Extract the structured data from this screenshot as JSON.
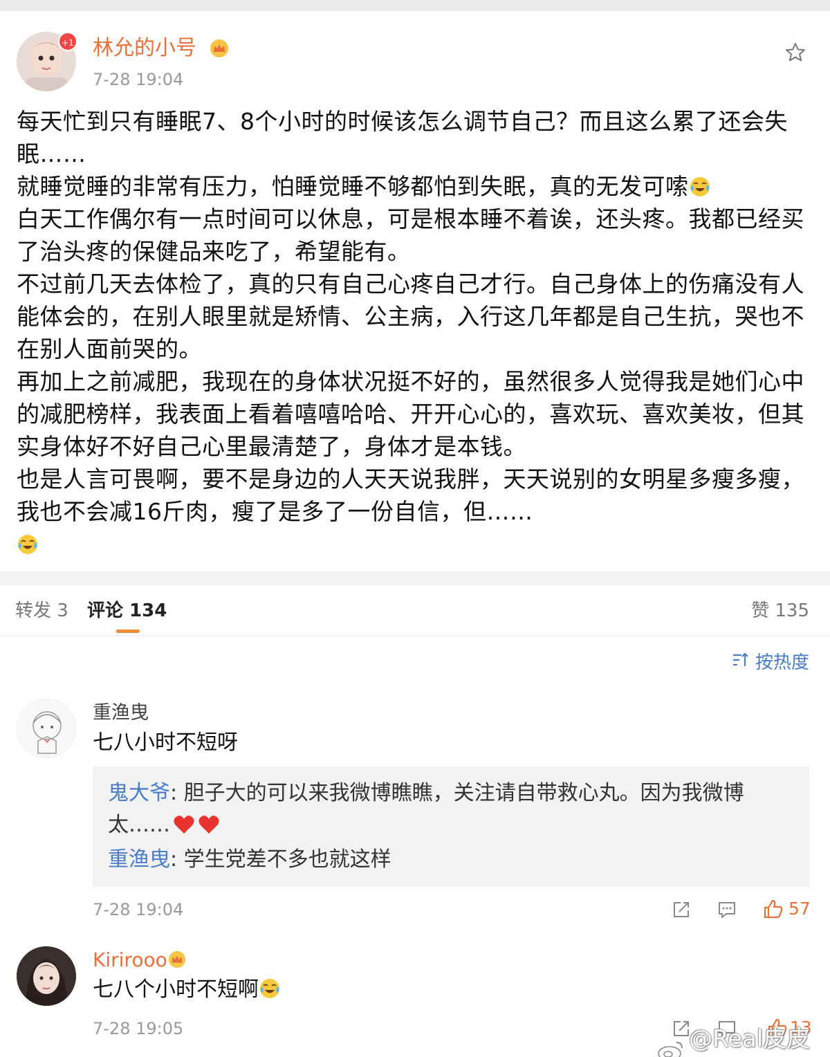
{
  "post": {
    "username": "林允的小号",
    "notification_badge": "+1",
    "timestamp": "7-28 19:04",
    "paragraphs": [
      "每天忙到只有睡眠7、8个小时的时候该怎么调节自己？而且这么累了还会失眠……",
      "就睡觉睡的非常有压力，怕睡觉睡不够都怕到失眠，真的无发可嗦",
      "白天工作偶尔有一点时间可以休息，可是根本睡不着诶，还头疼。我都已经买了治头疼的保健品来吃了，希望能有。",
      "不过前几天去体检了，真的只有自己心疼自己才行。自己身体上的伤痛没有人能体会的，在别人眼里就是矫情、公主病，入行这几年都是自己生抗，哭也不在别人面前哭的。",
      "再加上之前减肥，我现在的身体状况挺不好的，虽然很多人觉得我是她们心中的减肥榜样，我表面上看着嘻嘻哈哈、开开心心的，喜欢玩、喜欢美妆，但其实身体好不好自己心里最清楚了，身体才是本钱。",
      "也是人言可畏啊，要不是身边的人天天说我胖，天天说别的女明星多瘦多瘦，我也不会减16斤肉，瘦了是多了一份自信，但……"
    ]
  },
  "tabs": {
    "repost": "转发 3",
    "comments": "评论 134",
    "likes": "赞 135"
  },
  "sort_label": "按热度",
  "comments": [
    {
      "name": "重渔曳",
      "text": "七八小时不短呀",
      "replies": [
        {
          "name": "鬼大爷",
          "text": "胆子大的可以来我微博瞧瞧，关注请自带救心丸。因为我微博太……"
        },
        {
          "name": "重渔曳",
          "text": "学生党差不多也就这样"
        }
      ],
      "timestamp": "7-28 19:04",
      "likes": "57"
    },
    {
      "name": "Kirirooo",
      "text": "七八个小时不短啊",
      "timestamp": "7-28 19:05",
      "likes": "13"
    }
  ],
  "watermark": "@Real皮皮王",
  "colors": {
    "username": "#e8713a",
    "link_blue": "#4a7cc7",
    "tab_underline": "#f08b3a"
  }
}
